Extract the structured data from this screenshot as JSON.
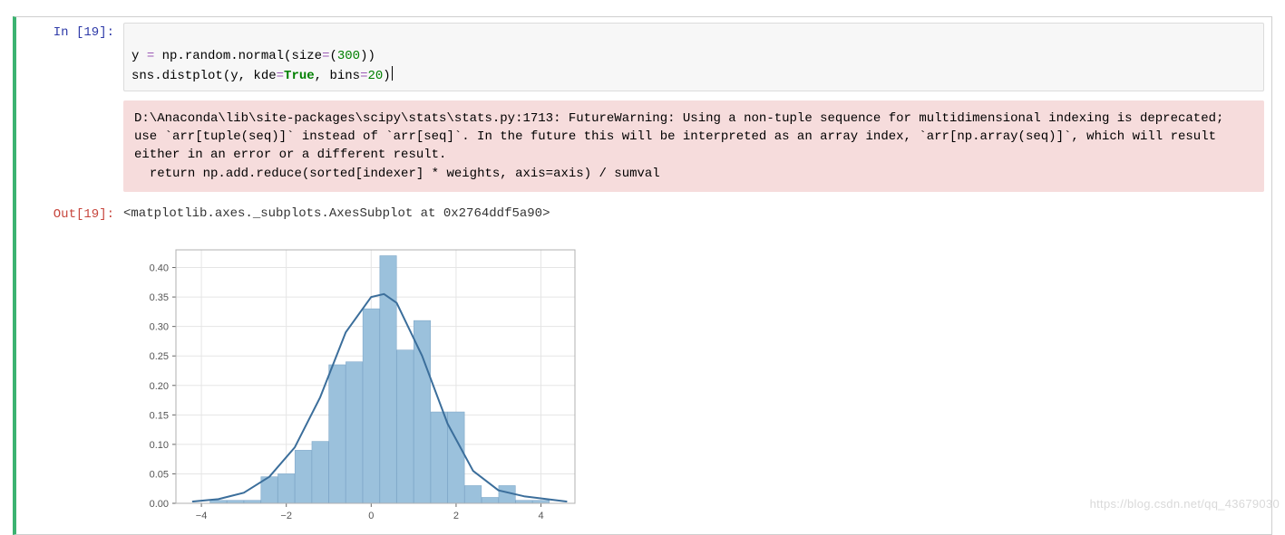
{
  "prompt_in": "In  [19]:",
  "prompt_out": "Out[19]:",
  "code_lines": {
    "l1_a": "y ",
    "l1_b": "=",
    "l1_c": " np.random.normal(size",
    "l1_d": "=",
    "l1_e": "(",
    "l1_f": "300",
    "l1_g": "))",
    "l2_a": "sns.distplot(y, kde",
    "l2_b": "=",
    "l2_c": "True",
    "l2_d": ", bins",
    "l2_e": "=",
    "l2_f": "20",
    "l2_g": ")"
  },
  "warning_text": "D:\\Anaconda\\lib\\site-packages\\scipy\\stats\\stats.py:1713: FutureWarning: Using a non-tuple sequence for multidimensional indexing is deprecated; use `arr[tuple(seq)]` instead of `arr[seq]`. In the future this will be interpreted as an array index, `arr[np.array(seq)]`, which will result either in an error or a different result.\n  return np.add.reduce(sorted[indexer] * weights, axis=axis) / sumval",
  "output_text": "<matplotlib.axes._subplots.AxesSubplot at 0x2764ddf5a90>",
  "watermark": "https://blog.csdn.net/qq_43679030",
  "chart_data": {
    "type": "bar",
    "overlay": "kde-line",
    "bins": 20,
    "categories": [
      -3.6,
      -3.2,
      -2.8,
      -2.4,
      -2.0,
      -1.6,
      -1.2,
      -0.8,
      -0.4,
      0.0,
      0.4,
      0.8,
      1.2,
      1.6,
      2.0,
      2.4,
      2.8,
      3.2,
      3.6,
      4.0
    ],
    "values": [
      0.005,
      0.005,
      0.005,
      0.045,
      0.05,
      0.09,
      0.105,
      0.235,
      0.24,
      0.33,
      0.42,
      0.26,
      0.31,
      0.155,
      0.155,
      0.03,
      0.01,
      0.03,
      0.005,
      0.005
    ],
    "kde": {
      "x": [
        -4.2,
        -3.6,
        -3.0,
        -2.4,
        -1.8,
        -1.2,
        -0.6,
        0.0,
        0.3,
        0.6,
        1.2,
        1.8,
        2.4,
        3.0,
        3.6,
        4.6
      ],
      "y": [
        0.003,
        0.007,
        0.018,
        0.045,
        0.095,
        0.18,
        0.29,
        0.35,
        0.355,
        0.34,
        0.25,
        0.135,
        0.055,
        0.022,
        0.012,
        0.003
      ]
    },
    "x_ticks": [
      -4,
      -2,
      0,
      2,
      4
    ],
    "y_ticks": [
      0.0,
      0.05,
      0.1,
      0.15,
      0.2,
      0.25,
      0.3,
      0.35,
      0.4
    ],
    "xlim": [
      -4.6,
      4.8
    ],
    "ylim": [
      0,
      0.43
    ],
    "title": "",
    "xlabel": "",
    "ylabel": ""
  }
}
